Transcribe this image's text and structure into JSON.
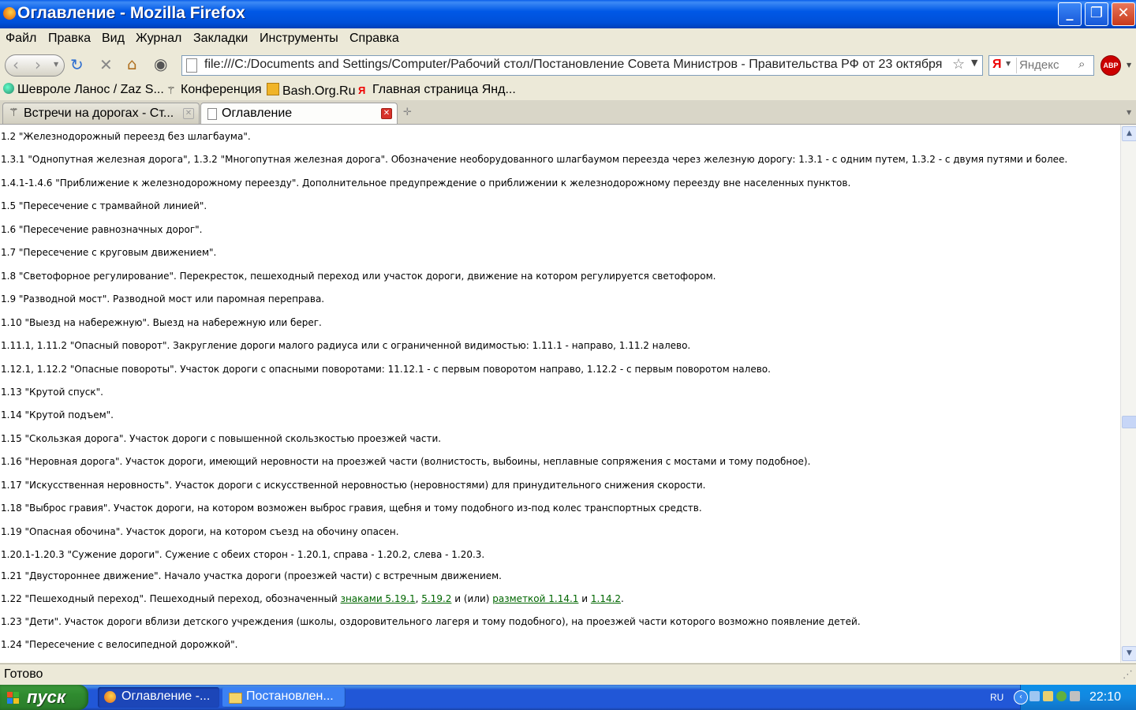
{
  "window": {
    "title": "Оглавление - Mozilla Firefox",
    "minimize_glyph": "_",
    "restore_glyph": "❐",
    "close_glyph": "✕"
  },
  "menu": [
    "Файл",
    "Правка",
    "Вид",
    "Журнал",
    "Закладки",
    "Инструменты",
    "Справка"
  ],
  "navigation": {
    "url": "file:///C:/Documents and Settings/Computer/Рабочий стол/Постановление Совета Министров - Правительства РФ от 23 октября",
    "search_engine_logo": "Я",
    "search_placeholder": "Яндекс",
    "adblock_label": "ABP"
  },
  "bookmarks": [
    "Шевроле Ланос / Zaz S...",
    "Конференция",
    "Bash.Org.Ru",
    "Главная страница Янд..."
  ],
  "tabs": [
    {
      "label": "Встречи на дорогах - Ст...",
      "active": false
    },
    {
      "label": "Оглавление",
      "active": true
    }
  ],
  "content_lines": [
    "1.2 \"Железнодорожный переезд без шлагбаума\".",
    "1.3.1 \"Однопутная железная дорога\", 1.3.2 \"Многопутная железная дорога\". Обозначение необорудованного шлагбаумом переезда через железную дорогу: 1.3.1 - с одним путем, 1.3.2 - с двумя путями и более.",
    "1.4.1-1.4.6 \"Приближение к железнодорожному переезду\". Дополнительное предупреждение о приближении к железнодорожному переезду вне населенных пунктов.",
    "1.5 \"Пересечение с трамвайной линией\".",
    "1.6 \"Пересечение равнозначных дорог\".",
    "1.7 \"Пересечение с круговым движением\".",
    "1.8 \"Светофорное регулирование\". Перекресток, пешеходный переход или участок дороги, движение на котором регулируется светофором.",
    "1.9 \"Разводной мост\". Разводной мост или паромная переправа.",
    "1.10 \"Выезд на набережную\". Выезд на набережную или берег.",
    "1.11.1, 1.11.2 \"Опасный поворот\". Закругление дороги малого радиуса или с ограниченной видимостью: 1.11.1 - направо, 1.11.2 налево.",
    "1.12.1, 1.12.2 \"Опасные повороты\". Участок дороги с опасными поворотами: 11.12.1 - с первым поворотом направо, 1.12.2 - с первым поворотом налево.",
    "1.13 \"Крутой спуск\".",
    "1.14 \"Крутой подъем\".",
    "1.15 \"Скользкая дорога\". Участок дороги с повышенной скользкостью проезжей части.",
    "1.16 \"Неровная дорога\". Участок дороги, имеющий неровности на проезжей части (волнистость, выбоины, неплавные сопряжения с мостами и тому подобное).",
    "1.17 \"Искусственная неровность\". Участок дороги с искусственной неровностью (неровностями) для принудительного снижения скорости.",
    "1.18 \"Выброс гравия\". Участок дороги, на котором возможен выброс гравия, щебня и тому подобного из-под колес транспортных средств.",
    "1.19 \"Опасная обочина\". Участок дороги, на котором съезд на обочину опасен.",
    "1.20.1-1.20.3 \"Сужение дороги\". Сужение с обеих сторон - 1.20.1, справа - 1.20.2, слева - 1.20.3."
  ],
  "line_1_21": "1.21 \"Двустороннее движение\". Начало участка дороги (проезжей части) с встречным движением.",
  "line_1_22": {
    "prefix": "1.22 \"Пешеходный переход\". Пешеходный переход, обозначенный ",
    "link1": "знаками 5.19.1",
    "sep1": ", ",
    "link2": "5.19.2",
    "mid": " и (или) ",
    "link3": "разметкой 1.14.1",
    "mid2": " и ",
    "link4": "1.14.2",
    "end": "."
  },
  "line_1_23": "1.23 \"Дети\". Участок дороги вблизи детского учреждения (школы, оздоровительного лагеря и тому подобного), на проезжей части которого возможно появление детей.",
  "line_1_24": "1.24 \"Пересечение с велосипедной дорожкой\".",
  "status": {
    "text": "Готово"
  },
  "taskbar": {
    "start_label": "пуск",
    "items": [
      "Оглавление -...",
      "Постановлен..."
    ],
    "language": "RU",
    "clock": "22:10"
  },
  "colors": {
    "link": "#006600",
    "titlebar": "#0058e6",
    "taskbar": "#2157d7",
    "start": "#2f8a2f"
  }
}
